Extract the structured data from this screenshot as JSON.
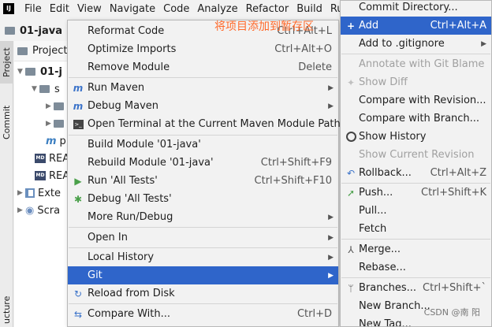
{
  "menubar": {
    "logo_text": "IJ",
    "items": [
      "File",
      "Edit",
      "View",
      "Navigate",
      "Code",
      "Analyze",
      "Refactor",
      "Build",
      "Run"
    ]
  },
  "project": {
    "name": "01-java"
  },
  "stripe": {
    "project_tab": "Project",
    "commit_tab": "Commit",
    "structure_tab": "ucture"
  },
  "tree": {
    "header": "Project",
    "root": "01-j",
    "src": "s",
    "pom": "p",
    "readme1": "REA",
    "readme2": "REA",
    "external": "Exte",
    "scratches": "Scra"
  },
  "annotation": "将项目添加到暂存区",
  "menu1": {
    "reformat": {
      "label": "Reformat Code",
      "shortcut": "Ctrl+Alt+L"
    },
    "optimize": {
      "label": "Optimize Imports",
      "shortcut": "Ctrl+Alt+O"
    },
    "remove_module": {
      "label": "Remove Module",
      "shortcut": "Delete"
    },
    "run_maven": {
      "label": "Run Maven"
    },
    "debug_maven": {
      "label": "Debug Maven"
    },
    "open_terminal": {
      "label": "Open Terminal at the Current Maven Module Path"
    },
    "build_module": {
      "label": "Build Module '01-java'"
    },
    "rebuild_module": {
      "label": "Rebuild Module '01-java'",
      "shortcut": "Ctrl+Shift+F9"
    },
    "run_tests": {
      "label": "Run 'All Tests'",
      "shortcut": "Ctrl+Shift+F10"
    },
    "debug_tests": {
      "label": "Debug 'All Tests'"
    },
    "more_run": {
      "label": "More Run/Debug"
    },
    "open_in": {
      "label": "Open In"
    },
    "local_history": {
      "label": "Local History"
    },
    "git": {
      "label": "Git"
    },
    "reload": {
      "label": "Reload from Disk"
    },
    "compare_with": {
      "label": "Compare With...",
      "shortcut": "Ctrl+D"
    }
  },
  "menu2": {
    "commit_dir": {
      "label": "Commit Directory..."
    },
    "add": {
      "label": "Add",
      "shortcut": "Ctrl+Alt+A"
    },
    "gitignore": {
      "label": "Add to .gitignore"
    },
    "annotate": {
      "label": "Annotate with Git Blame"
    },
    "show_diff": {
      "label": "Show Diff"
    },
    "compare_revision": {
      "label": "Compare with Revision..."
    },
    "compare_branch": {
      "label": "Compare with Branch..."
    },
    "show_history": {
      "label": "Show History"
    },
    "show_current_revision": {
      "label": "Show Current Revision"
    },
    "rollback": {
      "label": "Rollback...",
      "shortcut": "Ctrl+Alt+Z"
    },
    "push": {
      "label": "Push...",
      "shortcut": "Ctrl+Shift+K"
    },
    "pull": {
      "label": "Pull..."
    },
    "fetch": {
      "label": "Fetch"
    },
    "merge": {
      "label": "Merge..."
    },
    "rebase": {
      "label": "Rebase..."
    },
    "branches": {
      "label": "Branches...",
      "shortcut": "Ctrl+Shift+`"
    },
    "new_branch": {
      "label": "New Branch..."
    },
    "new_tag": {
      "label": "New Tag..."
    }
  },
  "watermark": "CSDN @南 阳",
  "colors": {
    "selection": "#2f65ca",
    "annotation": "#ff6a2b"
  }
}
